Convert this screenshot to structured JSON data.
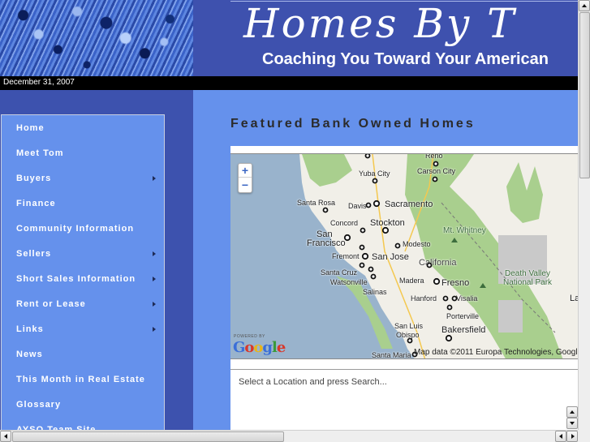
{
  "header": {
    "site_title": "Homes By T",
    "tagline": "Coaching You Toward Your American"
  },
  "date_bar": {
    "date": "December 31, 2007"
  },
  "nav": {
    "items": [
      {
        "label": "Home",
        "has_submenu": false
      },
      {
        "label": "Meet Tom",
        "has_submenu": false
      },
      {
        "label": "Buyers",
        "has_submenu": true
      },
      {
        "label": "Finance",
        "has_submenu": false
      },
      {
        "label": "Community Information",
        "has_submenu": false
      },
      {
        "label": "Sellers",
        "has_submenu": true
      },
      {
        "label": "Short Sales Information",
        "has_submenu": true
      },
      {
        "label": "Rent or Lease",
        "has_submenu": true
      },
      {
        "label": "Links",
        "has_submenu": true
      },
      {
        "label": "News",
        "has_submenu": false
      },
      {
        "label": "This Month in Real Estate",
        "has_submenu": false
      },
      {
        "label": "Glossary",
        "has_submenu": false
      },
      {
        "label": "AYSO Team Site",
        "has_submenu": false
      }
    ]
  },
  "main": {
    "title": "Featured Bank Owned Homes",
    "map": {
      "zoom_in": "+",
      "zoom_out": "−",
      "powered_by": "POWERED BY",
      "google_logo": [
        "G",
        "o",
        "o",
        "g",
        "l",
        "e"
      ],
      "attribution": "Map data ©2011 Europa Technologies, Googl",
      "labels": {
        "reno": "Reno",
        "carson_city": "Carson City",
        "yuba_city": "Yuba City",
        "santa_rosa": "Santa Rosa",
        "davis": "Davis",
        "sacramento": "Sacramento",
        "concord": "Concord",
        "stockton": "Stockton",
        "san": "San",
        "francisco": "Francisco",
        "modesto": "Modesto",
        "mt_whitney": "Mt. Whitney",
        "fremont": "Fremont",
        "san_jose": "San Jose",
        "california": "California",
        "santa_cruz": "Santa Cruz",
        "watsonville": "Watsonville",
        "madera": "Madera",
        "fresno": "Fresno",
        "death_valley_1": "Death Valley",
        "death_valley_2": "National Park",
        "salinas": "Salinas",
        "hanford": "Hanford",
        "visalia": "Visalia",
        "porterville": "Porterville",
        "san_luis": "San Luis",
        "obispo": "Obispo",
        "bakersfield": "Bakersfield",
        "santa_maria": "Santa Maria",
        "la": "La"
      }
    },
    "results_text": "Select a Location and press Search..."
  },
  "colors": {
    "header_bg": "#3e51ae",
    "nav_bg": "#6591ec",
    "main_bg": "#6591ec",
    "date_bar_bg": "#000000",
    "title_text": "#2b2b2b"
  }
}
